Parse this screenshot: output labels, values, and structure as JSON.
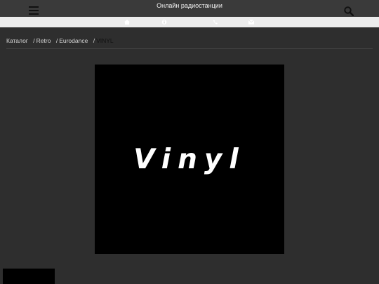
{
  "header": {
    "title": "Онлайн радиостанции",
    "menu_icon": "hamburger-icon",
    "search_icon": "search-icon"
  },
  "subbar": {
    "icons": [
      "home-icon",
      "info-icon",
      "phone-icon",
      "mail-icon"
    ]
  },
  "breadcrumb": {
    "items": [
      "Каталог",
      "Retro",
      "Eurodance"
    ],
    "current": "VINYL"
  },
  "station": {
    "cover_text": "Vinyl"
  }
}
